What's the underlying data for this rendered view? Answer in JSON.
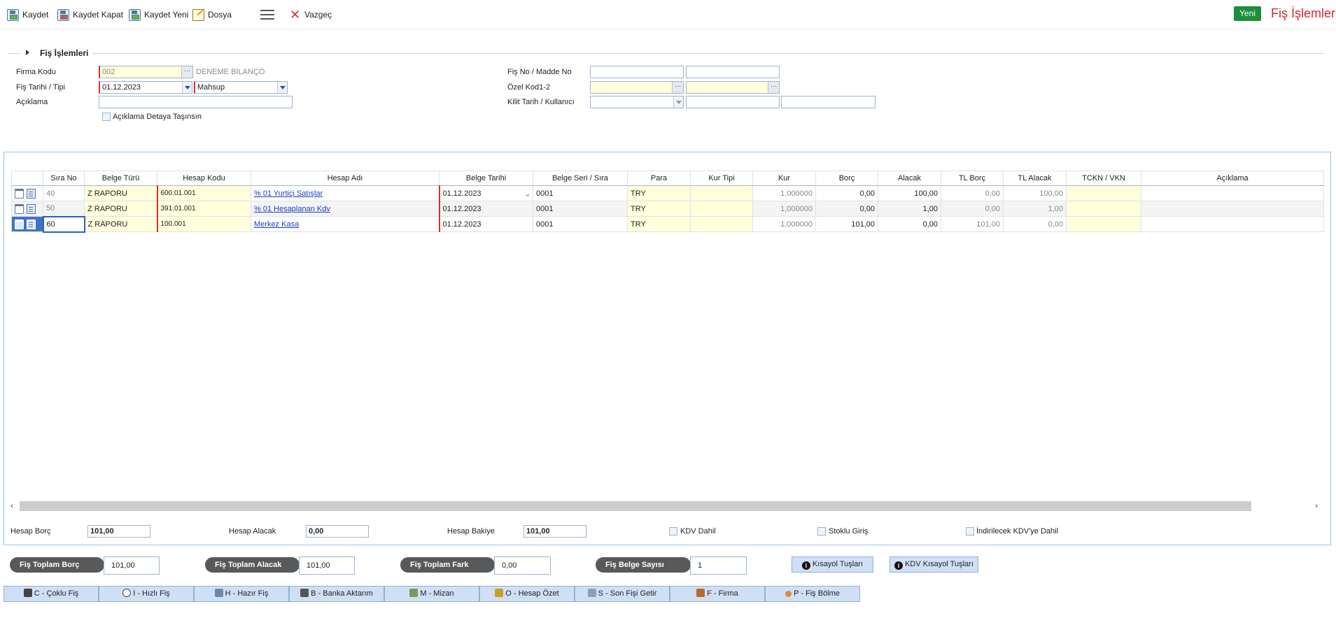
{
  "toolbar": {
    "save": "Kaydet",
    "save_close": "Kaydet Kapat",
    "save_new": "Kaydet Yeni",
    "file": "Dosya",
    "cancel": "Vazgeç",
    "new": "Yeni",
    "page_title": "Fiş İşlemleri"
  },
  "section": {
    "title": "Fiş İşlemleri"
  },
  "form": {
    "firma_kodu_label": "Firma Kodu",
    "firma_kodu_value": "002",
    "firma_name": "DENEME BİLANÇO",
    "fis_tarihi_label": "Fiş Tarihi / Tipi",
    "fis_tarihi_value": "01.12.2023",
    "fis_tipi_value": "Mahsup",
    "aciklama_label": "Açıklama",
    "aciklama_value": "",
    "aciklama_detay_label": "Açıklama Detaya Taşınsın",
    "fis_no_label": "Fiş No / Madde No",
    "ozel_kod_label": "Özel Kod1-2",
    "kilit_label": "Kilit Tarih / Kullanıcı"
  },
  "grid": {
    "columns": [
      "Sıra No",
      "Belge Türü",
      "Hesap Kodu",
      "Hesap Adı",
      "Belge Tarihi",
      "Belge Seri / Sıra",
      "Para",
      "Kur Tipi",
      "Kur",
      "Borç",
      "Alacak",
      "TL Borç",
      "TL Alacak",
      "TCKN / VKN",
      "Açıklama"
    ],
    "rows": [
      {
        "sira": "40",
        "belge_turu": "Z RAPORU",
        "hesap_kodu": "600.01.001",
        "hesap_adi": "% 01 Yurtiçi Satışlar",
        "belge_tarihi": "01.12.2023",
        "seri": "0001",
        "para": "TRY",
        "kur_tipi": "",
        "kur": "1,000000",
        "borc": "0,00",
        "alacak": "100,00",
        "tl_borc": "0,00",
        "tl_alacak": "100,00",
        "tckn": "",
        "aciklama": ""
      },
      {
        "sira": "50",
        "belge_turu": "Z RAPORU",
        "hesap_kodu": "391.01.001",
        "hesap_adi": "% 01 Hesaplanan Kdv",
        "belge_tarihi": "01.12.2023",
        "seri": "0001",
        "para": "TRY",
        "kur_tipi": "",
        "kur": "1,000000",
        "borc": "0,00",
        "alacak": "1,00",
        "tl_borc": "0,00",
        "tl_alacak": "1,00",
        "tckn": "",
        "aciklama": ""
      },
      {
        "sira": "60",
        "belge_turu": "Z RAPORU",
        "hesap_kodu": "100.001",
        "hesap_adi": "Merkez Kasa",
        "belge_tarihi": "01.12.2023",
        "seri": "0001",
        "para": "TRY",
        "kur_tipi": "",
        "kur": "1,000000",
        "borc": "101,00",
        "alacak": "0,00",
        "tl_borc": "101,00",
        "tl_alacak": "0,00",
        "tckn": "",
        "aciklama": ""
      }
    ]
  },
  "summary": {
    "hesap_borc_label": "Hesap Borç",
    "hesap_borc_value": "101,00",
    "hesap_alacak_label": "Hesap Alacak",
    "hesap_alacak_value": "0,00",
    "hesap_bakiye_label": "Hesap Bakiye",
    "hesap_bakiye_value": "101,00",
    "kdv_dahil": "KDV Dahil",
    "stoklu_giris": "Stoklu Giriş",
    "indirilecek_kdv": "İndirilecek KDV'ye Dahil"
  },
  "totals": {
    "toplam_borc_label": "Fiş Toplam Borç",
    "toplam_borc_value": "101,00",
    "toplam_alacak_label": "Fiş Toplam Alacak",
    "toplam_alacak_value": "101,00",
    "toplam_fark_label": "Fiş Toplam Fark",
    "toplam_fark_value": "0,00",
    "belge_sayisi_label": "Fiş Belge Sayısı",
    "belge_sayisi_value": "1",
    "kisayol": "Kısayol Tuşları",
    "kdv_kisayol": "KDV Kısayol Tuşları"
  },
  "bottom_buttons": [
    {
      "label": "C - Çoklu Fiş",
      "icon": "calculator-icon",
      "color": "#444444"
    },
    {
      "label": "İ - Hızlı Fiş",
      "icon": "stopwatch-icon",
      "color": "#444444"
    },
    {
      "label": "H - Hazır Fiş",
      "icon": "document-icon",
      "color": "#6a8aa8"
    },
    {
      "label": "B - Banka Aktarım",
      "icon": "bank-card-icon",
      "color": "#555555"
    },
    {
      "label": "M - Mizan",
      "icon": "scale-icon",
      "color": "#7a9a5a"
    },
    {
      "label": "O - Hesap Özet",
      "icon": "pencil-icon",
      "color": "#c9a020"
    },
    {
      "label": "S - Son Fişi Getir",
      "icon": "receipt-icon",
      "color": "#8aa0b8"
    },
    {
      "label": "F - Firma",
      "icon": "factory-icon",
      "color": "#b86a2a"
    },
    {
      "label": "P - Fiş Bölme",
      "icon": "circle-icon",
      "color": "#e08a3a"
    }
  ]
}
